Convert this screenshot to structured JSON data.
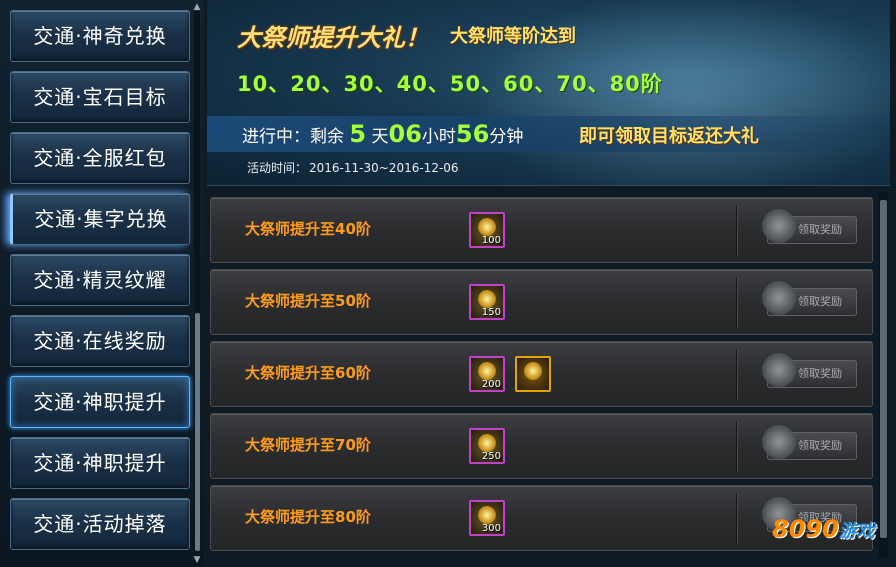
{
  "nav": {
    "items": [
      {
        "label": "交通·神奇兑换"
      },
      {
        "label": "交通·宝石目标"
      },
      {
        "label": "交通·全服红包"
      },
      {
        "label": "交通·集字兑换"
      },
      {
        "label": "交通·精灵纹耀"
      },
      {
        "label": "交通·在线奖励"
      },
      {
        "label": "交通·神职提升"
      },
      {
        "label": "交通·神职提升"
      },
      {
        "label": "交通·活动掉落"
      }
    ],
    "active_index": 6
  },
  "banner": {
    "title": "大祭师提升大礼！",
    "subtitle": "大祭师等阶达到",
    "levels": "10、20、30、40、50、60、70、80阶",
    "status_prefix": "进行中：剩余",
    "days": "5",
    "days_unit": "天",
    "hours": "06",
    "hours_unit": "小时",
    "minutes": "56",
    "minutes_unit": "分钟",
    "reward_text": "即可领取目标返还大礼",
    "time_label": "活动时间：",
    "time_range": "2016-11-30~2016-12-06"
  },
  "rewards": [
    {
      "label": "大祭师提升至40阶",
      "items": [
        {
          "qty": "100",
          "icon": "medal-icon"
        }
      ],
      "button": "领取奖励"
    },
    {
      "label": "大祭师提升至50阶",
      "items": [
        {
          "qty": "150",
          "icon": "medal-icon"
        }
      ],
      "button": "领取奖励"
    },
    {
      "label": "大祭师提升至60阶",
      "items": [
        {
          "qty": "200",
          "icon": "medal-icon"
        },
        {
          "qty": "",
          "icon": "treasure-icon"
        }
      ],
      "button": "领取奖励"
    },
    {
      "label": "大祭师提升至70阶",
      "items": [
        {
          "qty": "250",
          "icon": "medal-icon"
        }
      ],
      "button": "领取奖励"
    },
    {
      "label": "大祭师提升至80阶",
      "items": [
        {
          "qty": "300",
          "icon": "medal-icon"
        }
      ],
      "button": "领取奖励"
    }
  ],
  "watermark": {
    "brand": "8090",
    "suffix": "游戏"
  }
}
